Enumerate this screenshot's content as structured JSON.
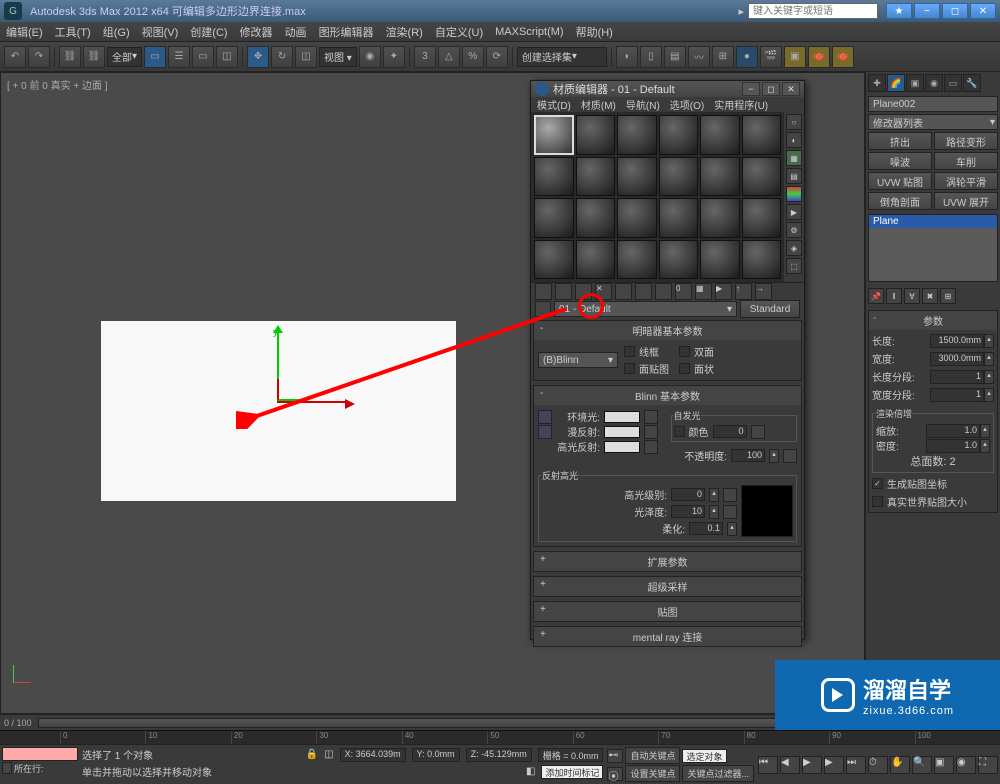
{
  "titlebar": {
    "app_title": "Autodesk 3ds Max  2012 x64     可编辑多边形边界连接.max",
    "search_placeholder": "键入关键字或短语"
  },
  "menubar": [
    "编辑(E)",
    "工具(T)",
    "组(G)",
    "视图(V)",
    "创建(C)",
    "修改器",
    "动画",
    "图形编辑器",
    "渲染(R)",
    "自定义(U)",
    "MAXScript(M)",
    "帮助(H)"
  ],
  "toolbar": {
    "scope": "全部",
    "selset": "创建选择集"
  },
  "viewport": {
    "label": "[ + 0 前 0 真实 + 边面 ]",
    "axis_y": "y"
  },
  "right_panel": {
    "object_name": "Plane002",
    "modifier_dd": "修改器列表",
    "buttons": [
      [
        "挤出",
        "路径变形"
      ],
      [
        "噪波",
        "车削"
      ],
      [
        "UVW 贴图",
        "涡轮平滑"
      ],
      [
        "倒角剖面",
        "UVW 展开"
      ]
    ],
    "stack_item": "Plane",
    "rollout_params": "参数",
    "length_lbl": "长度:",
    "length_val": "1500.0mm",
    "width_lbl": "宽度:",
    "width_val": "3000.0mm",
    "lseg_lbl": "长度分段:",
    "lseg_val": "1",
    "wseg_lbl": "宽度分段:",
    "wseg_val": "1",
    "render_mult": "渲染倍增",
    "scale_lbl": "缩放:",
    "scale_val": "1.0",
    "dens_lbl": "密度:",
    "dens_val": "1.0",
    "total_lbl": "总面数: 2",
    "genmap": "生成贴图坐标",
    "realworld": "真实世界贴图大小"
  },
  "mat_editor": {
    "title": "材质编辑器 - 01 - Default",
    "menu": [
      "模式(D)",
      "材质(M)",
      "导航(N)",
      "选项(O)",
      "实用程序(U)"
    ],
    "mat_name": "01 - Default",
    "type_btn": "Standard",
    "roll_shader": "明暗器基本参数",
    "shader": "(B)Blinn",
    "chk_wire": "线框",
    "chk_2side": "双面",
    "chk_facemap": "面贴图",
    "chk_faceted": "面状",
    "roll_blinn": "Blinn 基本参数",
    "selfillum": "自发光",
    "selfillum_color": "颜色",
    "selfillum_val": "0",
    "ambient": "环境光:",
    "diffuse": "漫反射:",
    "specular": "高光反射:",
    "opacity": "不透明度:",
    "opacity_val": "100",
    "spec_hl": "反射高光",
    "spec_level": "高光级别:",
    "spec_level_val": "0",
    "gloss": "光泽度:",
    "gloss_val": "10",
    "soften": "柔化:",
    "soften_val": "0.1",
    "roll_ext": "扩展参数",
    "roll_ss": "超级采样",
    "roll_maps": "贴图",
    "roll_mr": "mental ray 连接"
  },
  "timeline": {
    "frame": "0 / 100"
  },
  "status": {
    "sel_info": "选择了 1 个对象",
    "hint": "单击并拖动以选择并移动对象",
    "x": "X: 3664.039m",
    "y": "Y: 0.0mm",
    "z": "Z: -45.129mm",
    "grid": "栅格 = 0.0mm",
    "autokey": "自动关键点",
    "selset": "选定对象",
    "addtag": "添加时间标记",
    "setkey": "设置关键点",
    "keyfilter": "关键点过滤器...",
    "nowplaying": "所在行:"
  },
  "watermark": {
    "main": "溜溜自学",
    "sub": "zixue.3d66.com"
  }
}
